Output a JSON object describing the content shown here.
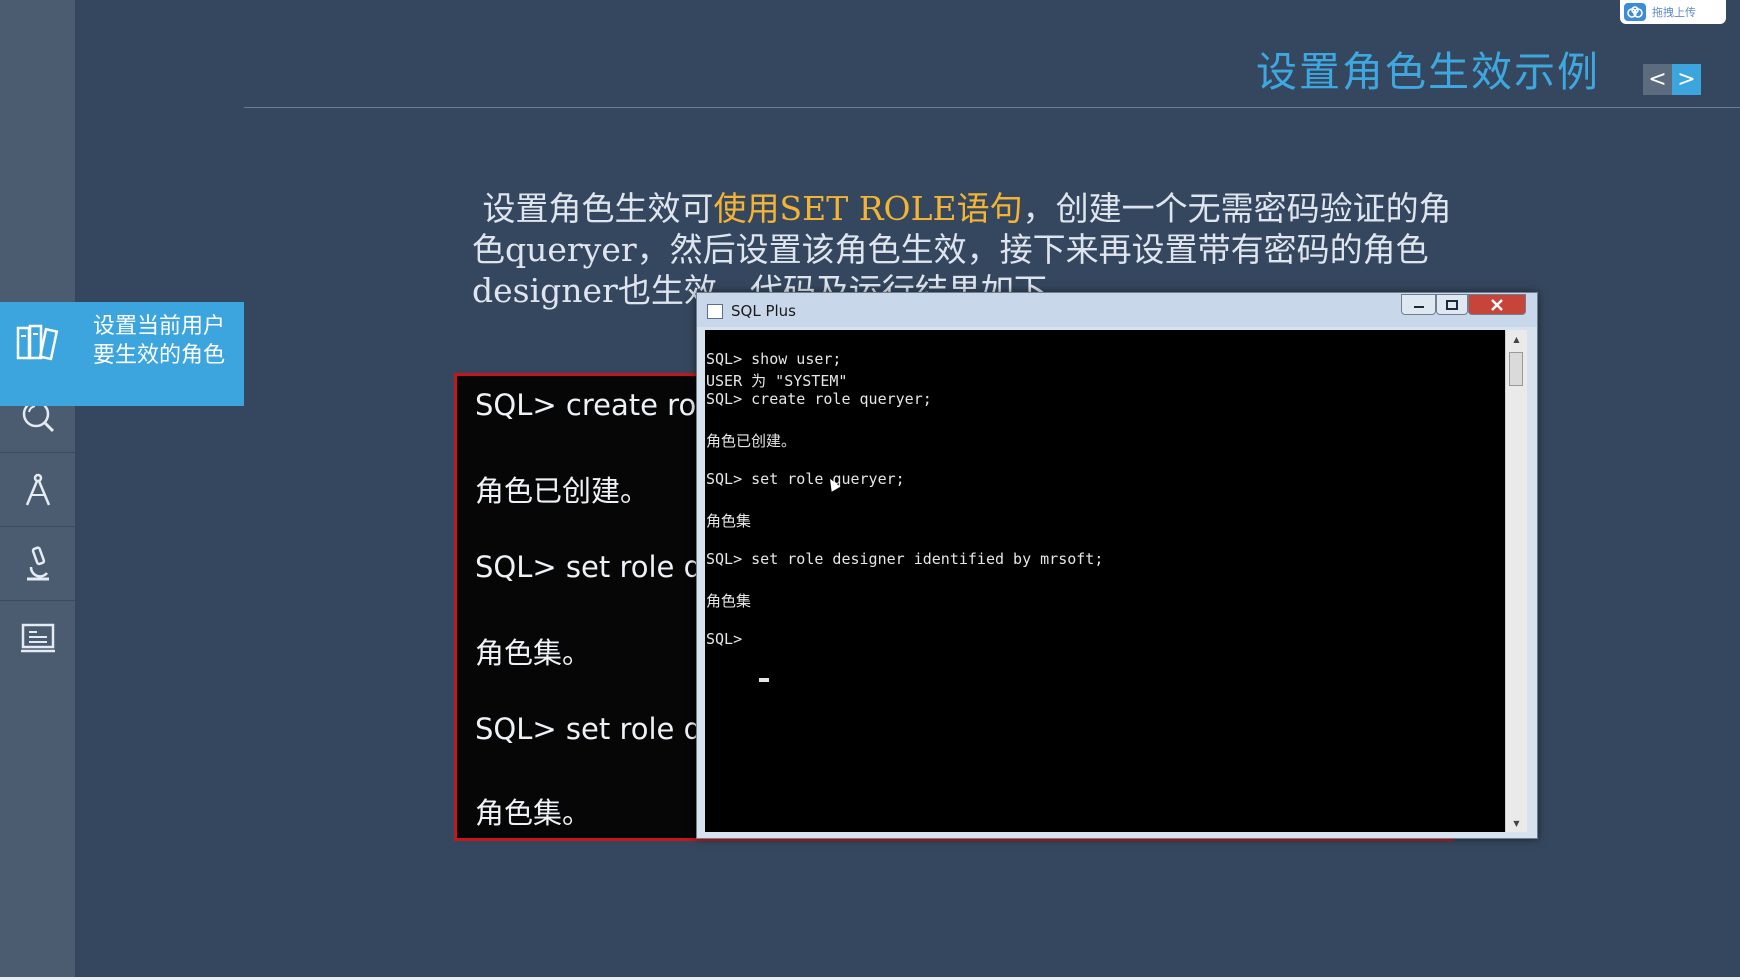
{
  "slide": {
    "title": "设置角色生效示例",
    "paragraph": {
      "part1": "设置角色生效可",
      "highlight": "使用SET ROLE语句",
      "part2": "，创建一个无需密码验证的角色queryer，然后设置该角色生效，接下来再设置带有密码的角色designer也生效，代码及运行结果如下。"
    },
    "highlight_color": "#f3b434",
    "accent_color": "#3da5de"
  },
  "nav": {
    "prev_label": "<",
    "next_label": ">"
  },
  "upload_button": {
    "label": "拖拽上传"
  },
  "sidebar": {
    "active_item": {
      "label": "设置当前用户要生效的角色",
      "icon": "books-icon"
    },
    "items": [
      {
        "icon": "search-icon"
      },
      {
        "icon": "compass-icon"
      },
      {
        "icon": "microscope-icon"
      },
      {
        "icon": "monitor-icon"
      }
    ]
  },
  "code_box": {
    "lines": [
      "SQL> create role",
      "角色已创建。",
      "SQL> set role qu",
      "角色集。",
      "SQL> set role de",
      "角色集。"
    ]
  },
  "sqlplus_window": {
    "title": "SQL Plus",
    "console_lines": [
      "SQL> show user;",
      "USER 为 \"SYSTEM\"",
      "SQL> create role queryer;",
      "",
      "角色已创建。",
      "",
      "SQL> set role queryer;",
      "",
      "角色集",
      "",
      "SQL> set role designer identified by mrsoft;",
      "",
      "角色集",
      "",
      "SQL> "
    ]
  }
}
